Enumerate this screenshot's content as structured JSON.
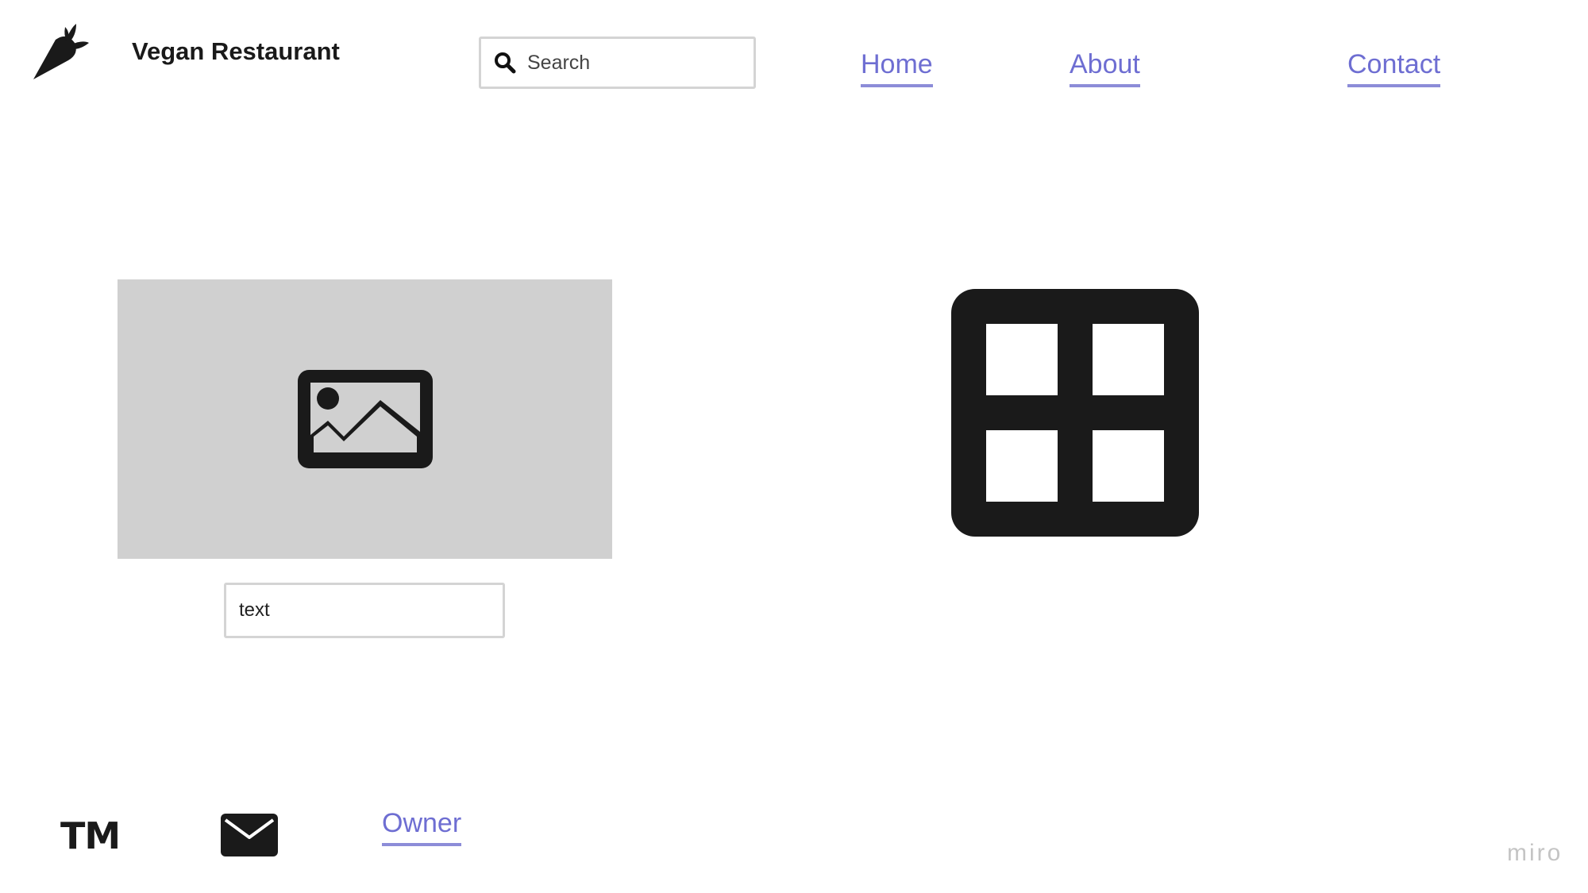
{
  "header": {
    "brand": "Vegan Restaurant",
    "logo_icon": "carrot-icon",
    "search": {
      "placeholder": "Search",
      "icon": "search-icon"
    },
    "nav": {
      "home": "Home",
      "about": "About",
      "contact": "Contact"
    }
  },
  "main": {
    "image_icon": "image-icon",
    "text_field_value": "text",
    "grid_icon": "grid-icon"
  },
  "footer": {
    "trademark": "TM",
    "mail_icon": "mail-icon",
    "owner_link": "Owner"
  },
  "watermark": "miro",
  "colors": {
    "link": "#6e6ed2",
    "link_underline": "#8c8cd8",
    "placeholder_bg": "#d0d0d0",
    "icon": "#1a1a1a"
  }
}
